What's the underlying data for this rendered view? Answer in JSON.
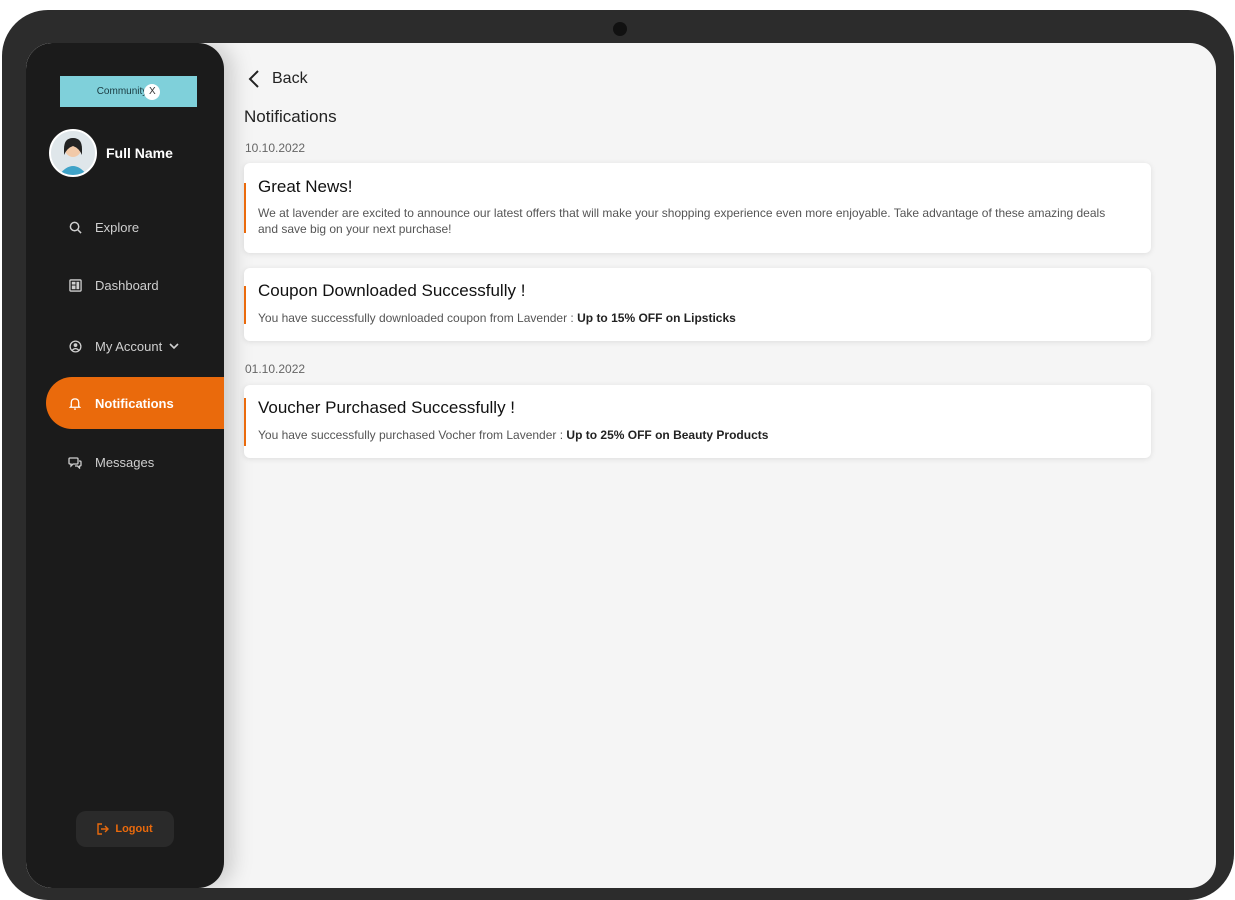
{
  "brand": {
    "logo_text": "Community",
    "logo_mark": "X"
  },
  "profile": {
    "name": "Full Name"
  },
  "sidebar": {
    "items": [
      {
        "label": "Explore",
        "icon": "search-icon"
      },
      {
        "label": "Dashboard",
        "icon": "dashboard-icon"
      },
      {
        "label": "My Account",
        "icon": "account-icon",
        "has_dropdown": true
      },
      {
        "label": "Notifications",
        "icon": "bell-icon",
        "active": true
      },
      {
        "label": "Messages",
        "icon": "chat-icon"
      }
    ],
    "logout_label": "Logout"
  },
  "main": {
    "back_label": "Back",
    "title": "Notifications",
    "groups": [
      {
        "date": "10.10.2022",
        "notifications": [
          {
            "title": "Great News!",
            "body": "We at lavender are excited to announce our latest offers that will make your shopping experience even more enjoyable. Take advantage of these amazing deals and save big on your next purchase!"
          },
          {
            "title": "Coupon Downloaded Successfully !",
            "body_prefix": "You have successfully downloaded coupon from Lavender : ",
            "body_highlight": "Up to 15% OFF on Lipsticks"
          }
        ]
      },
      {
        "date": "01.10.2022",
        "notifications": [
          {
            "title": "Voucher Purchased Successfully !",
            "body_prefix": "You have successfully purchased Vocher from Lavender : ",
            "body_highlight": "Up to 25% OFF on Beauty Products"
          }
        ]
      }
    ]
  },
  "colors": {
    "accent": "#ea6a0c",
    "sidebar_bg": "#1b1b1b",
    "logo_bg": "#7fd0da",
    "content_bg": "#f5f5f5"
  }
}
